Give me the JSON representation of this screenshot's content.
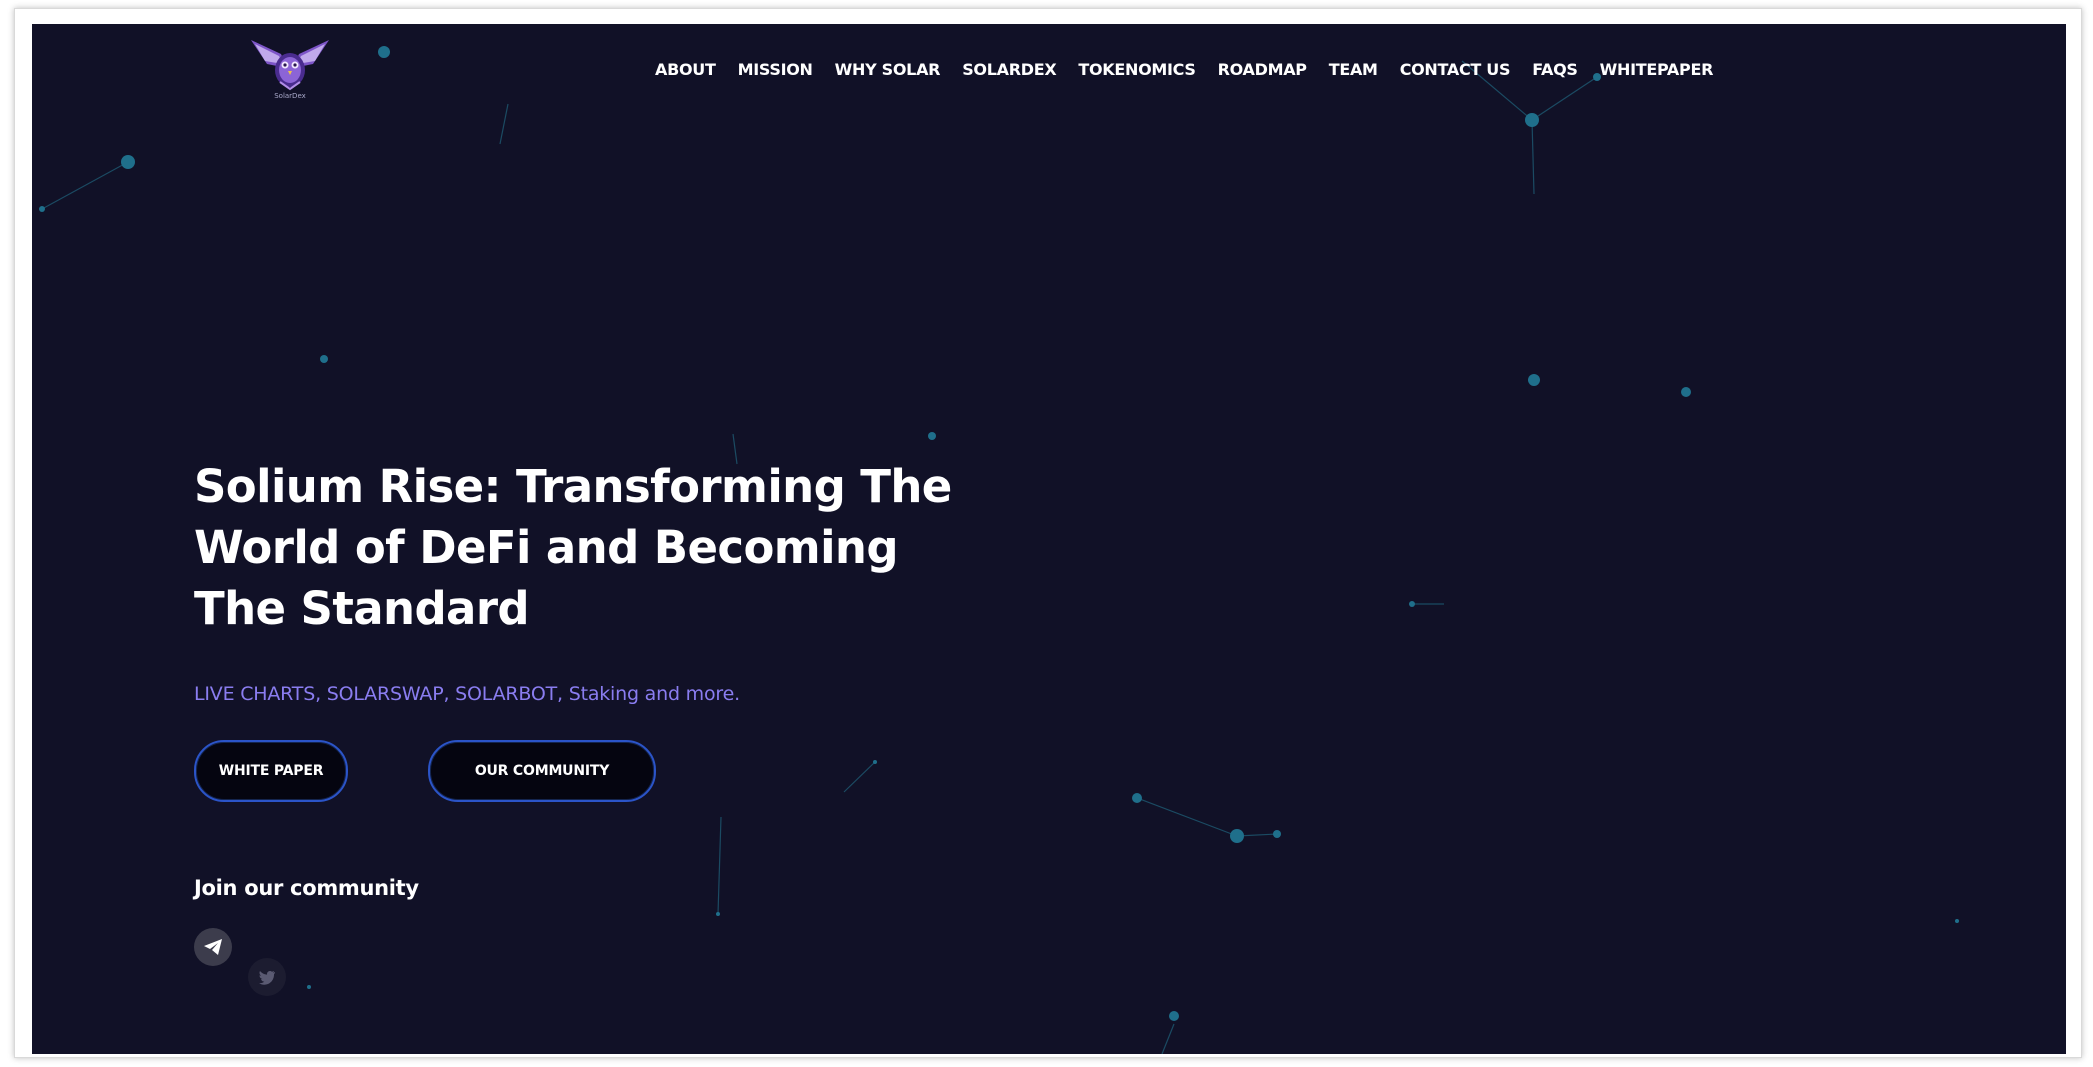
{
  "nav": {
    "items": [
      "ABOUT",
      "MISSION",
      "WHY SOLAR",
      "SOLARDEX",
      "TOKENOMICS",
      "ROADMAP",
      "TEAM",
      "CONTACT US",
      "FAQS",
      "WHITEPAPER"
    ]
  },
  "logo": {
    "icon": "winged-owl-logo",
    "caption": "SolarDex"
  },
  "hero": {
    "headline": "Solium Rise: Transforming The World of DeFi and Becoming The Standard",
    "tagline": "LIVE CHARTS, SOLARSWAP, SOLARBOT, Staking and more.",
    "white_paper_label": "WHITE PAPER",
    "community_label": "OUR COMMUNITY",
    "join_label": "Join our community"
  },
  "social": {
    "telegram_icon": "telegram-icon",
    "twitter_icon": "twitter-icon"
  },
  "colors": {
    "background": "#111127",
    "accent": "#8a7df0",
    "button_border": "#2b54c8",
    "particle": "#1f6f8b"
  }
}
